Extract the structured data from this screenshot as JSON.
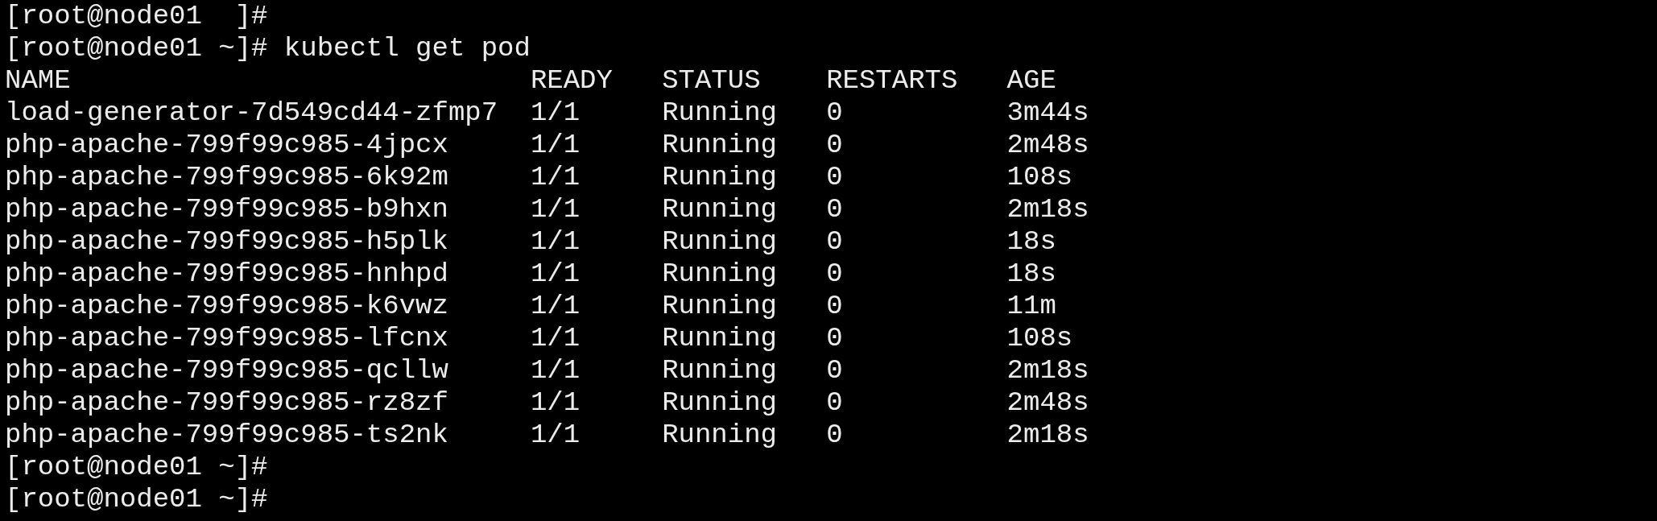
{
  "lines_before": [
    {
      "prompt": "[root@node01  ]#"
    }
  ],
  "command_line": {
    "prompt": "[root@node01 ~]#",
    "command": "kubectl get pod"
  },
  "table": {
    "columns": [
      "NAME",
      "READY",
      "STATUS",
      "RESTARTS",
      "AGE"
    ],
    "rows": [
      [
        "load-generator-7d549cd44-zfmp7",
        "1/1",
        "Running",
        "0",
        "3m44s"
      ],
      [
        "php-apache-799f99c985-4jpcx",
        "1/1",
        "Running",
        "0",
        "2m48s"
      ],
      [
        "php-apache-799f99c985-6k92m",
        "1/1",
        "Running",
        "0",
        "108s"
      ],
      [
        "php-apache-799f99c985-b9hxn",
        "1/1",
        "Running",
        "0",
        "2m18s"
      ],
      [
        "php-apache-799f99c985-h5plk",
        "1/1",
        "Running",
        "0",
        "18s"
      ],
      [
        "php-apache-799f99c985-hnhpd",
        "1/1",
        "Running",
        "0",
        "18s"
      ],
      [
        "php-apache-799f99c985-k6vwz",
        "1/1",
        "Running",
        "0",
        "11m"
      ],
      [
        "php-apache-799f99c985-lfcnx",
        "1/1",
        "Running",
        "0",
        "108s"
      ],
      [
        "php-apache-799f99c985-qcllw",
        "1/1",
        "Running",
        "0",
        "2m18s"
      ],
      [
        "php-apache-799f99c985-rz8zf",
        "1/1",
        "Running",
        "0",
        "2m48s"
      ],
      [
        "php-apache-799f99c985-ts2nk",
        "1/1",
        "Running",
        "0",
        "2m18s"
      ]
    ]
  },
  "lines_after": [
    {
      "prompt": "[root@node01 ~]#"
    },
    {
      "prompt": "[root@node01 ~]#"
    }
  ]
}
